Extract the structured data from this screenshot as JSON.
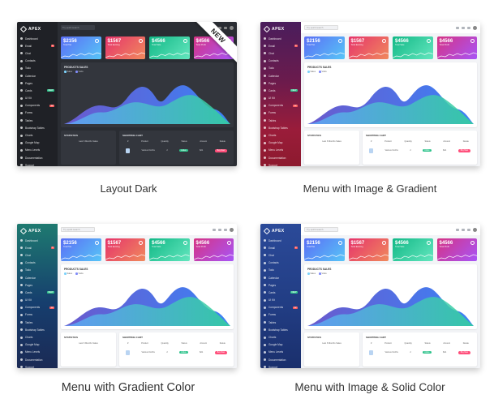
{
  "brand": "APEX",
  "ribbon": "NEW",
  "search_placeholder": "Try quick search",
  "menu": [
    {
      "label": "Dashboard",
      "badge": ""
    },
    {
      "label": "Email",
      "badge": "4"
    },
    {
      "label": "Chat",
      "badge": ""
    },
    {
      "label": "Contacts",
      "badge": ""
    },
    {
      "label": "Todo",
      "badge": ""
    },
    {
      "label": "Calendar",
      "badge": ""
    },
    {
      "label": "Pages",
      "badge": ""
    },
    {
      "label": "Cards",
      "badge": "NEW"
    },
    {
      "label": "UI Kit",
      "badge": ""
    },
    {
      "label": "Components",
      "badge": "12"
    },
    {
      "label": "Forms",
      "badge": ""
    },
    {
      "label": "Tables",
      "badge": ""
    },
    {
      "label": "Bootstrap Tables",
      "badge": ""
    },
    {
      "label": "Charts",
      "badge": ""
    },
    {
      "label": "Google Map",
      "badge": ""
    },
    {
      "label": "Menu Levels",
      "badge": ""
    },
    {
      "label": "Documentation",
      "badge": ""
    },
    {
      "label": "Support",
      "badge": ""
    }
  ],
  "cards": [
    {
      "value": "$2156",
      "label": "Total Tax",
      "gradient": [
        "#5b6ef5",
        "#57c5f7"
      ]
    },
    {
      "value": "$1567",
      "label": "Total Earning",
      "gradient": [
        "#e6336b",
        "#f08a5d"
      ]
    },
    {
      "value": "$4566",
      "label": "Total Sale",
      "gradient": [
        "#12b886",
        "#63e6be"
      ]
    },
    {
      "value": "$4566",
      "label": "Total Profit",
      "gradient": [
        "#d63384",
        "#a855f7"
      ]
    }
  ],
  "products_title": "PRODUCTS SALES",
  "legend": [
    "Sales",
    "Visits"
  ],
  "statistics_title": "STATISTICS",
  "statistics_sub": "Last 6 Months Sales",
  "cart_title": "SHOPPING CART",
  "cart_headers": [
    "#",
    "Product",
    "Quantity",
    "Status",
    "Amount",
    "Delete"
  ],
  "cart_row": {
    "product": "Various Norths",
    "qty": "2",
    "status": "Active",
    "amount": "$21",
    "action": "Buy Now"
  },
  "panels": [
    {
      "caption": "Layout Dark"
    },
    {
      "caption": "Menu with Image & Gradient"
    },
    {
      "caption": "Menu with Gradient Color"
    },
    {
      "caption": "Menu with Image & Solid Color"
    }
  ]
}
